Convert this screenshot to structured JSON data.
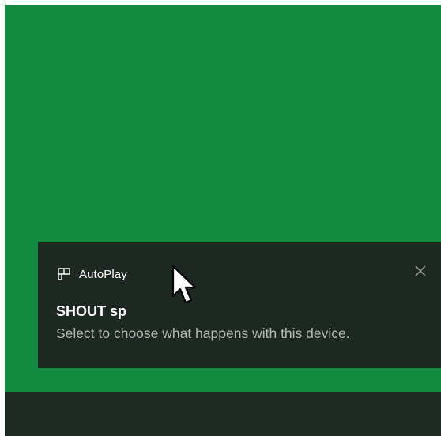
{
  "colors": {
    "desktop_background": "#128a40",
    "taskbar_background": "#1f2a24",
    "toast_background": "#1d2822",
    "toast_body_text": "#b5b9b7"
  },
  "toast": {
    "app_icon": "autoplay-icon",
    "app_name": "AutoPlay",
    "close_icon": "close-icon",
    "title": "SHOUT sp",
    "body": "Select to choose what happens with this device."
  },
  "cursor_icon": "arrow-cursor-icon"
}
